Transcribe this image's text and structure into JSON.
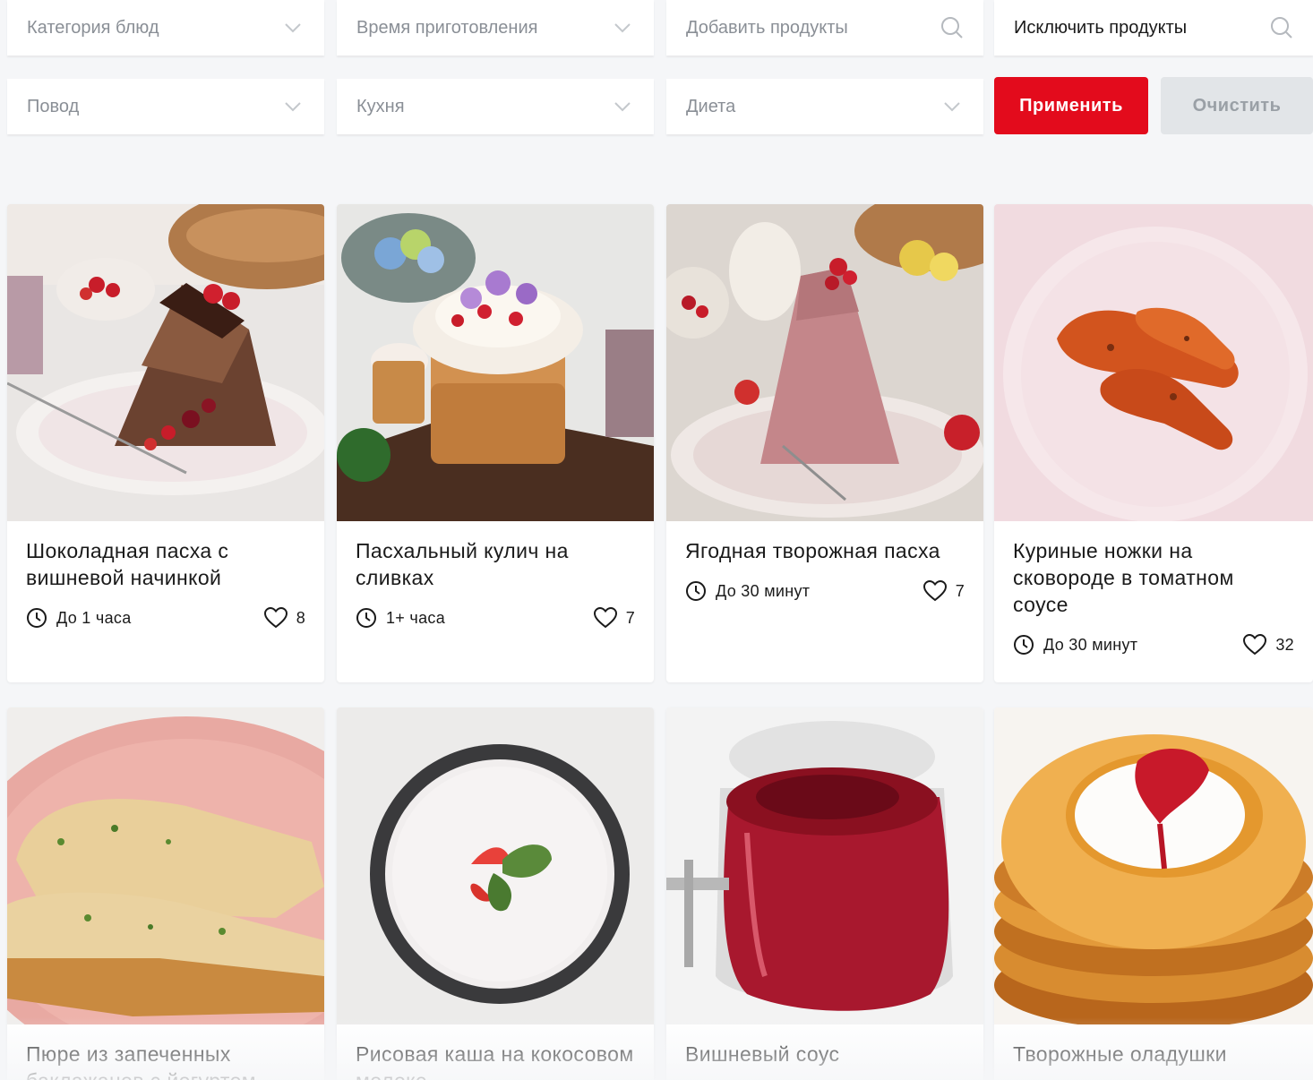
{
  "filters": {
    "dish_category": "Категория блюд",
    "cooking_time": "Время приготовления",
    "add_products": "Добавить продукты",
    "exclude_products": "Исключить продукты",
    "occasion": "Повод",
    "cuisine": "Кухня",
    "diet": "Диета",
    "apply_label": "Применить",
    "clear_label": "Очистить"
  },
  "colors": {
    "accent": "#e30b1c",
    "page_bg": "#f5f6f8",
    "muted": "#8a8f96"
  },
  "recipes": [
    {
      "title": "Шоколадная пасха с вишневой начинкой",
      "time": "До 1 часа",
      "likes": "8"
    },
    {
      "title": "Пасхальный кулич на сливках",
      "time": "1+ часа",
      "likes": "7"
    },
    {
      "title": "Ягодная творожная пасха",
      "time": "До 30 минут",
      "likes": "7"
    },
    {
      "title": "Куриные ножки на сковороде в томатном соусе",
      "time": "До 30 минут",
      "likes": "32"
    },
    {
      "title": "Пюре из запеченных баклажанов с йогуртом"
    },
    {
      "title": "Рисовая каша на кокосовом молоке"
    },
    {
      "title": "Вишневый соус"
    },
    {
      "title": "Творожные оладушки"
    }
  ]
}
